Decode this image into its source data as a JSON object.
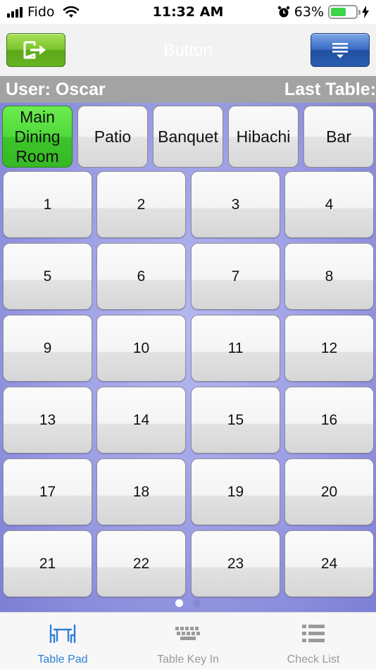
{
  "status_bar": {
    "carrier": "Fido",
    "time": "11:32 AM",
    "battery_percent": "63%",
    "battery_level": 0.63,
    "battery_color": "#3ed44a",
    "icons": [
      "signal-bars-icon",
      "wifi-icon",
      "alarm-icon",
      "battery-icon",
      "charging-bolt-icon"
    ]
  },
  "toolbar": {
    "title": "Button",
    "exit_icon": "exit-icon",
    "menu_icon": "menu-icon",
    "exit_color": "#6cb92a",
    "menu_color": "#2a5cb2"
  },
  "info_bar": {
    "user_label": "User: Oscar",
    "last_table_label": "Last Table:"
  },
  "rooms": [
    {
      "label": "Main Dining Room",
      "active": true
    },
    {
      "label": "Patio",
      "active": false
    },
    {
      "label": "Banquet",
      "active": false
    },
    {
      "label": "Hibachi",
      "active": false
    },
    {
      "label": "Bar",
      "active": false
    }
  ],
  "tables": [
    "1",
    "2",
    "3",
    "4",
    "5",
    "6",
    "7",
    "8",
    "9",
    "10",
    "11",
    "12",
    "13",
    "14",
    "15",
    "16",
    "17",
    "18",
    "19",
    "20",
    "21",
    "22",
    "23",
    "24"
  ],
  "pager": {
    "pages": 2,
    "current": 1
  },
  "tabs": [
    {
      "label": "Table Pad",
      "icon": "table-chairs-icon",
      "active": true
    },
    {
      "label": "Table Key In",
      "icon": "keyboard-icon",
      "active": false
    },
    {
      "label": "Check List",
      "icon": "list-icon",
      "active": false
    }
  ],
  "colors": {
    "active_room": "#4fd93a",
    "content_background": "#9a9ce4",
    "tab_active": "#2e7fd8",
    "tab_inactive": "#9a9a9a"
  }
}
